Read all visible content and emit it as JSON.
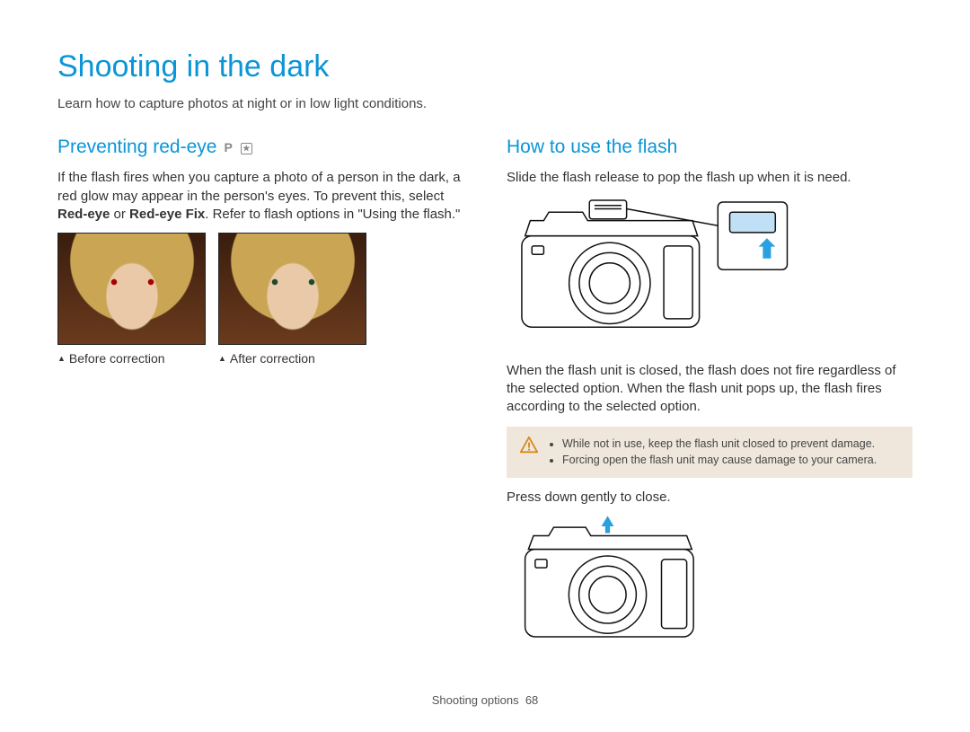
{
  "title": "Shooting in the dark",
  "intro": "Learn how to capture photos at night or in low light conditions.",
  "left": {
    "heading": "Preventing red-eye",
    "mode_p": "P",
    "body_pre": "If the flash fires when you capture a photo of a person in the dark, a red glow may appear in the person's eyes. To prevent this, select ",
    "bold1": "Red-eye",
    "body_mid": " or ",
    "bold2": "Red-eye Fix",
    "body_post": ". Refer to flash options in \"Using the flash.\"",
    "caption_before": "Before correction",
    "caption_after": "After correction"
  },
  "right": {
    "heading": "How to use the flash",
    "body1": "Slide the flash release to pop the flash up when it is need.",
    "body2": "When the flash unit is closed, the flash does not fire regardless of the selected option. When the flash unit pops up, the flash fires according to the selected option.",
    "warning_items": [
      "While not in use, keep the flash unit closed to prevent damage.",
      "Forcing open the flash unit may cause damage to your camera."
    ],
    "body3": "Press down gently to close."
  },
  "footer": {
    "section": "Shooting options",
    "page": "68"
  }
}
